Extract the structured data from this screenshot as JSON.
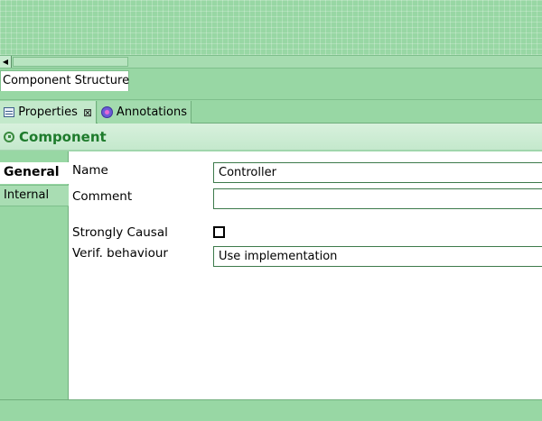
{
  "editor": {
    "tab_label": "Component Structure"
  },
  "views": {
    "tabs": [
      {
        "label": "Properties",
        "icon": "properties-icon",
        "closable": true
      },
      {
        "label": "Annotations",
        "icon": "annotations-icon"
      }
    ],
    "close_glyph": "⊠"
  },
  "section": {
    "title": "Component",
    "icon": "component-icon"
  },
  "sidetabs": {
    "items": [
      {
        "label": "General"
      },
      {
        "label": "Internal"
      }
    ]
  },
  "form": {
    "name_label": "Name",
    "name_value": "Controller",
    "comment_label": "Comment",
    "comment_value": "",
    "strongly_causal_label": "Strongly Causal",
    "strongly_causal_checked": false,
    "verif_label": "Verif. behaviour",
    "verif_value": "Use implementation"
  },
  "colors": {
    "background": "#98d7a4",
    "title_green": "#1e7b2c",
    "field_border": "#3d7a4b"
  }
}
